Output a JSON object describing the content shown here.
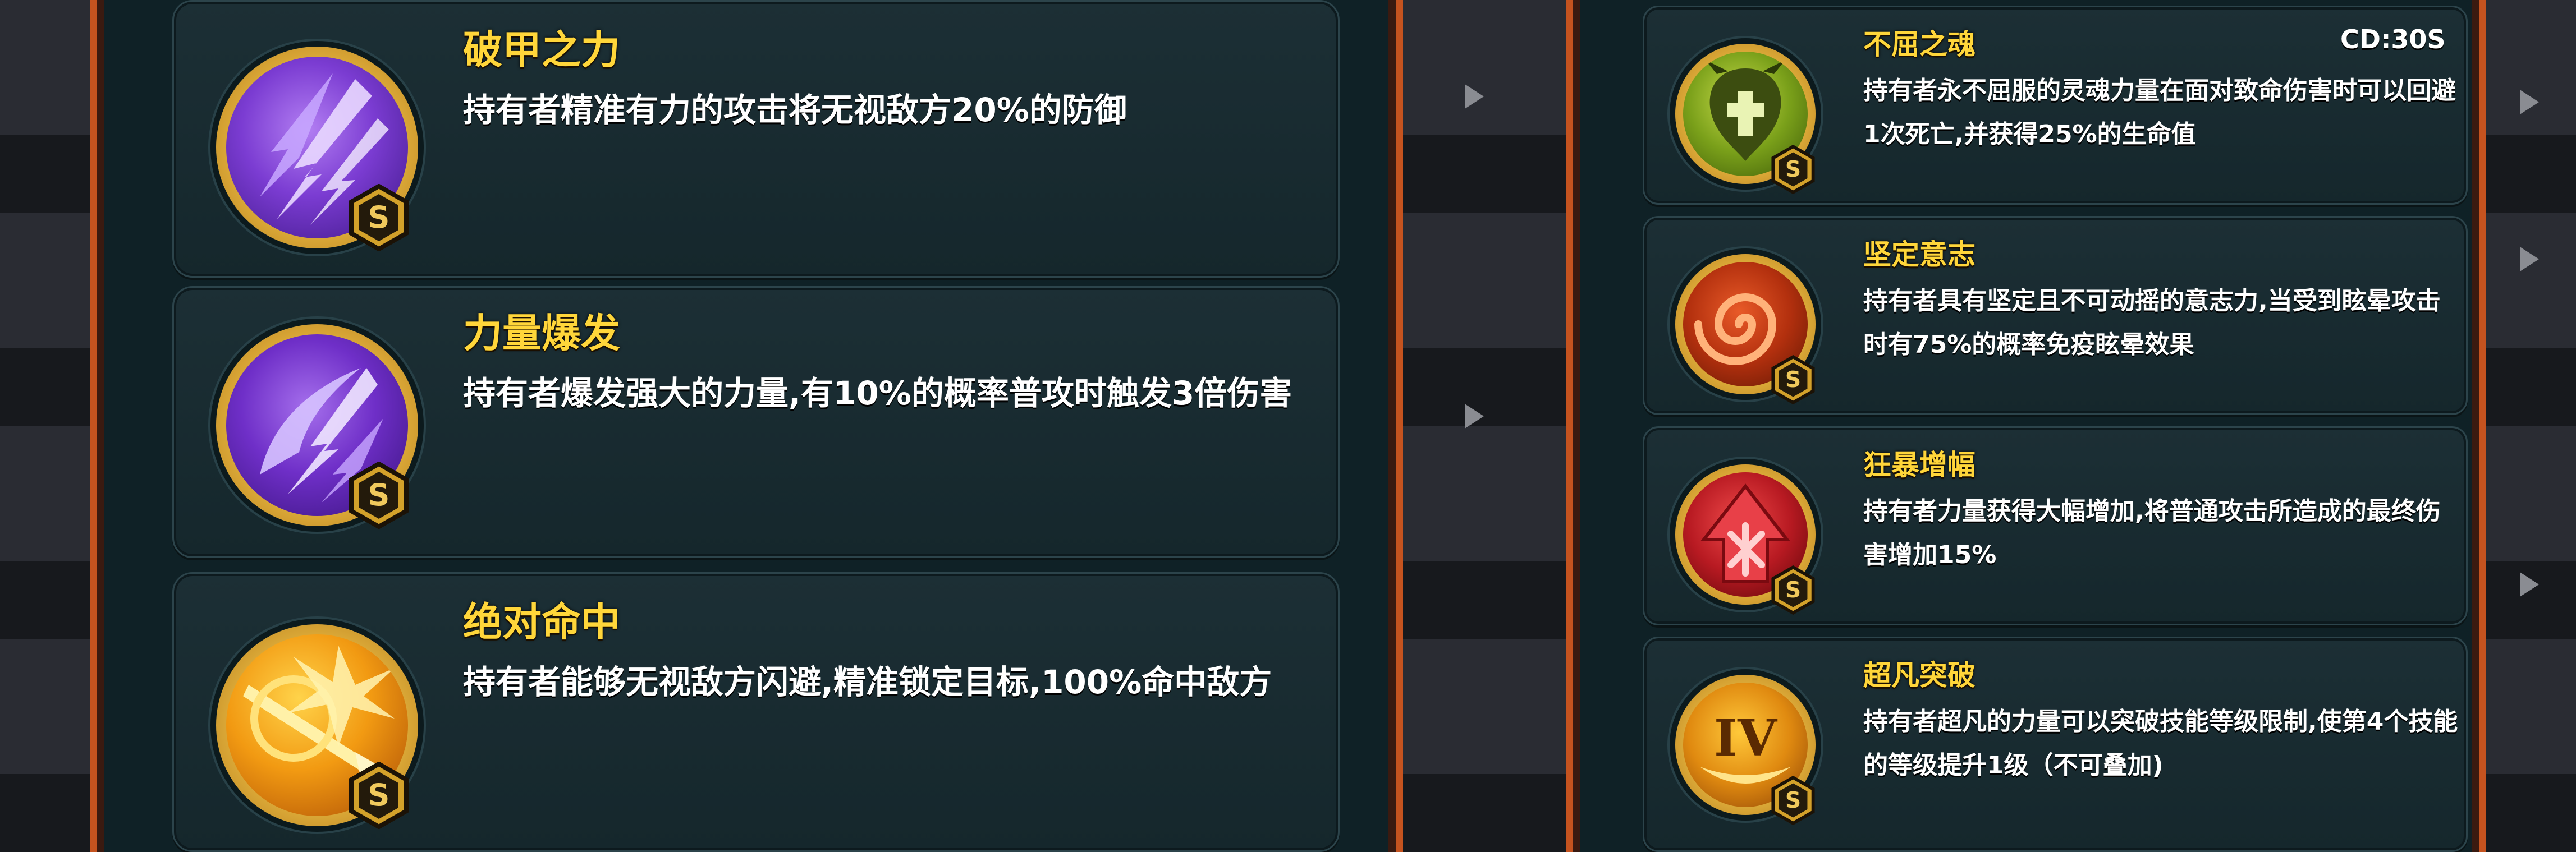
{
  "left_panel": {
    "skills": [
      {
        "icon": "armor-break-icon",
        "title": "破甲之力",
        "desc": "持有者精准有力的攻击将无视敌方20%的防御",
        "rank": "S"
      },
      {
        "icon": "power-burst-icon",
        "title": "力量爆发",
        "desc": "持有者爆发强大的力量,有10%的概率普攻时触发3倍伤害",
        "rank": "S"
      },
      {
        "icon": "absolute-hit-icon",
        "title": "绝对命中",
        "desc": "持有者能够无视敌方闪避,精准锁定目标,100%命中敌方",
        "rank": "S"
      }
    ]
  },
  "right_panel": {
    "skills": [
      {
        "icon": "unyielding-soul-icon",
        "title": "不屈之魂",
        "desc": "持有者永不屈服的灵魂力量在面对致命伤害时可以回避1次死亡,并获得25%的生命值",
        "rank": "S",
        "cooldown": "CD:30S"
      },
      {
        "icon": "firm-will-icon",
        "title": "坚定意志",
        "desc": "持有者具有坚定且不可动摇的意志力,当受到眩晕攻击时有75%的概率免疫眩晕效果",
        "rank": "S"
      },
      {
        "icon": "rage-amplify-icon",
        "title": "狂暴增幅",
        "desc": "持有者力量获得大幅增加,将普通攻击所造成的最终伤害增加15%",
        "rank": "S"
      },
      {
        "icon": "transcend-icon",
        "title": "超凡突破",
        "desc": "持有者超凡的力量可以突破技能等级限制,使第4个技能的等级提升1级（不可叠加)",
        "rank": "S",
        "icon_text": "IV"
      }
    ]
  }
}
